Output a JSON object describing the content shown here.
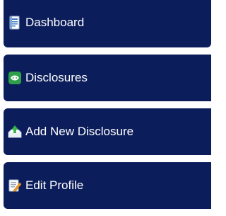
{
  "nav": {
    "items": [
      {
        "label": "Dashboard",
        "icon": "dashboard-icon"
      },
      {
        "label": "Disclosures",
        "icon": "disclosures-icon"
      },
      {
        "label": "Add New Disclosure",
        "icon": "add-new-disclosure-icon"
      },
      {
        "label": "Edit Profile",
        "icon": "edit-profile-icon"
      }
    ]
  },
  "colors": {
    "nav_background": "#0c1d5b",
    "nav_text": "#ffffff",
    "page_background": "#ffffff"
  }
}
